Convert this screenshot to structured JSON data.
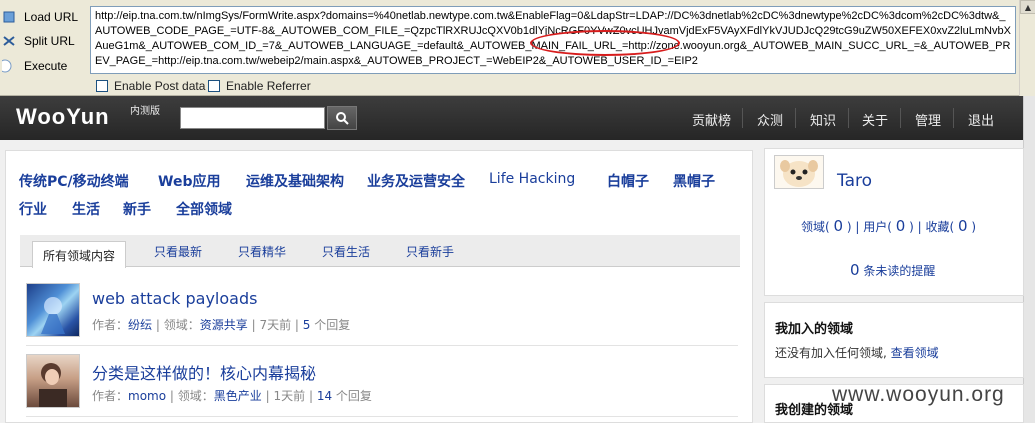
{
  "hackbar": {
    "load_url": "Load URL",
    "split_url": "Split URL",
    "execute": "Execute",
    "url_value": "http://eip.tna.com.tw/nImgSys/FormWrite.aspx?domains=%40netlab.newtype.com.tw&EnableFlag=0&LdapStr=LDAP://DC%3dnetlab%2cDC%3dnewtype%2cDC%3dcom%2cDC%3dtw&_AUTOWEB_CODE_PAGE_=UTF-8&_AUTOWEB_COM_FILE_=QzpcTlRXRUJcQXV0b1dlYjNcRGF0YVwZ0vcUHJvamVjdExF5VAyXFdlYkVJUDJcQ29tcG9uZW50XEFEX0xvZ2luLmNvbXAueG1m&_AUTOWEB_COM_ID_=7&_AUTOWEB_LANGUAGE_=default&_AUTOWEB_MAIN_FAIL_URL_=http://zone.wooyun.org&_AUTOWEB_MAIN_SUCC_URL_=&_AUTOWEB_PREV_PAGE_=http://eip.tna.com.tw/webeip2/main.aspx&_AUTOWEB_PROJECT_=WebEIP2&_AUTOWEB_USER_ID_=EIP2",
    "enable_post": "Enable Post data",
    "enable_referrer": "Enable Referrer",
    "highlight_color": "#d71c1c"
  },
  "header": {
    "logo": "WooYun",
    "logo_sub": "内测版",
    "nav": [
      "贡献榜",
      "众测",
      "知识",
      "关于",
      "管理",
      "退出"
    ]
  },
  "categories": {
    "row1": [
      "传统PC/移动终端",
      "Web应用",
      "运维及基础架构",
      "业务及运营安全",
      "Life Hacking",
      "白帽子",
      "黑帽子"
    ],
    "row2": [
      "行业",
      "生活",
      "新手",
      "全部领域"
    ]
  },
  "tabs": [
    "所有领域内容",
    "只看最新",
    "只看精华",
    "只看生活",
    "只看新手"
  ],
  "posts": [
    {
      "title": "web attack payloads",
      "author_label": "作者：",
      "author": "纷纭",
      "domain_label": "领域：",
      "domain": "资源共享",
      "time": "7天前",
      "replies_count": "5",
      "replies_label": "个回复"
    },
    {
      "title": "分类是这样做的！核心内幕揭秘",
      "author_label": "作者：",
      "author": "momo",
      "domain_label": "领域：",
      "domain": "黑色产业",
      "time": "1天前",
      "replies_count": "14",
      "replies_label": "个回复"
    }
  ],
  "sidebar": {
    "username": "Taro",
    "domain_label": "领域(",
    "domain_count": "0",
    "user_label": "用户(",
    "user_count": "0",
    "fav_label": "收藏(",
    "fav_count": "0",
    "close": ")",
    "unread_count": "0",
    "unread_label": "条未读的提醒",
    "joined_title": "我加入的领域",
    "joined_empty": "还没有加入任何领域,",
    "joined_link": "查看领域",
    "created_title": "我创建的领域"
  },
  "watermark": "www.wooyun.org",
  "colors": {
    "link": "#1a3e9b",
    "header_bg": "#333333",
    "toolbar_bg": "#ece9d8"
  }
}
